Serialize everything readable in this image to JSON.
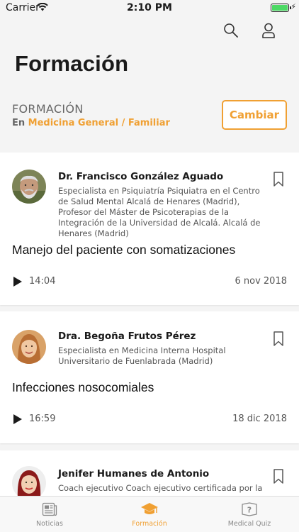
{
  "status_bar": {
    "carrier": "Carrier",
    "time": "2:10 PM"
  },
  "header": {
    "title": "Formación",
    "section_label": "FORMACIÓN",
    "specialty_prefix": "En",
    "specialty": "Medicina General / Familiar",
    "change_button": "Cambiar"
  },
  "cards": [
    {
      "author": "Dr. Francisco González Aguado",
      "bio": "Especialista en Psiquiatría Psiquiatra en el Centro de Salud Mental Alcalá de Henares (Madrid), Profesor del Máster de Psicoterapias de la Integración de la Universidad de Alcalá. Alcalá de Henares (Madrid)",
      "title": "Manejo del paciente con somatizaciones",
      "duration": "14:04",
      "date": "6 nov 2018"
    },
    {
      "author": "Dra. Begoña Frutos Pérez",
      "bio": "Especialista en Medicina Interna Hospital Universitario de Fuenlabrada (Madrid)",
      "title": "Infecciones nosocomiales",
      "duration": "16:59",
      "date": "18 dic 2018"
    },
    {
      "author": "Jenifer Humanes de Antonio",
      "bio": "Coach ejecutivo Coach ejecutivo certificada por la"
    }
  ],
  "tabbar": {
    "tabs": [
      {
        "label": "Noticias",
        "icon": "news-icon"
      },
      {
        "label": "Formación",
        "icon": "graduation-cap-icon"
      },
      {
        "label": "Medical Quiz",
        "icon": "quiz-icon"
      }
    ],
    "active_color": "#f0a033",
    "inactive_color": "#8a8a8a"
  },
  "colors": {
    "accent": "#f0a033",
    "battery": "#4cd964"
  }
}
